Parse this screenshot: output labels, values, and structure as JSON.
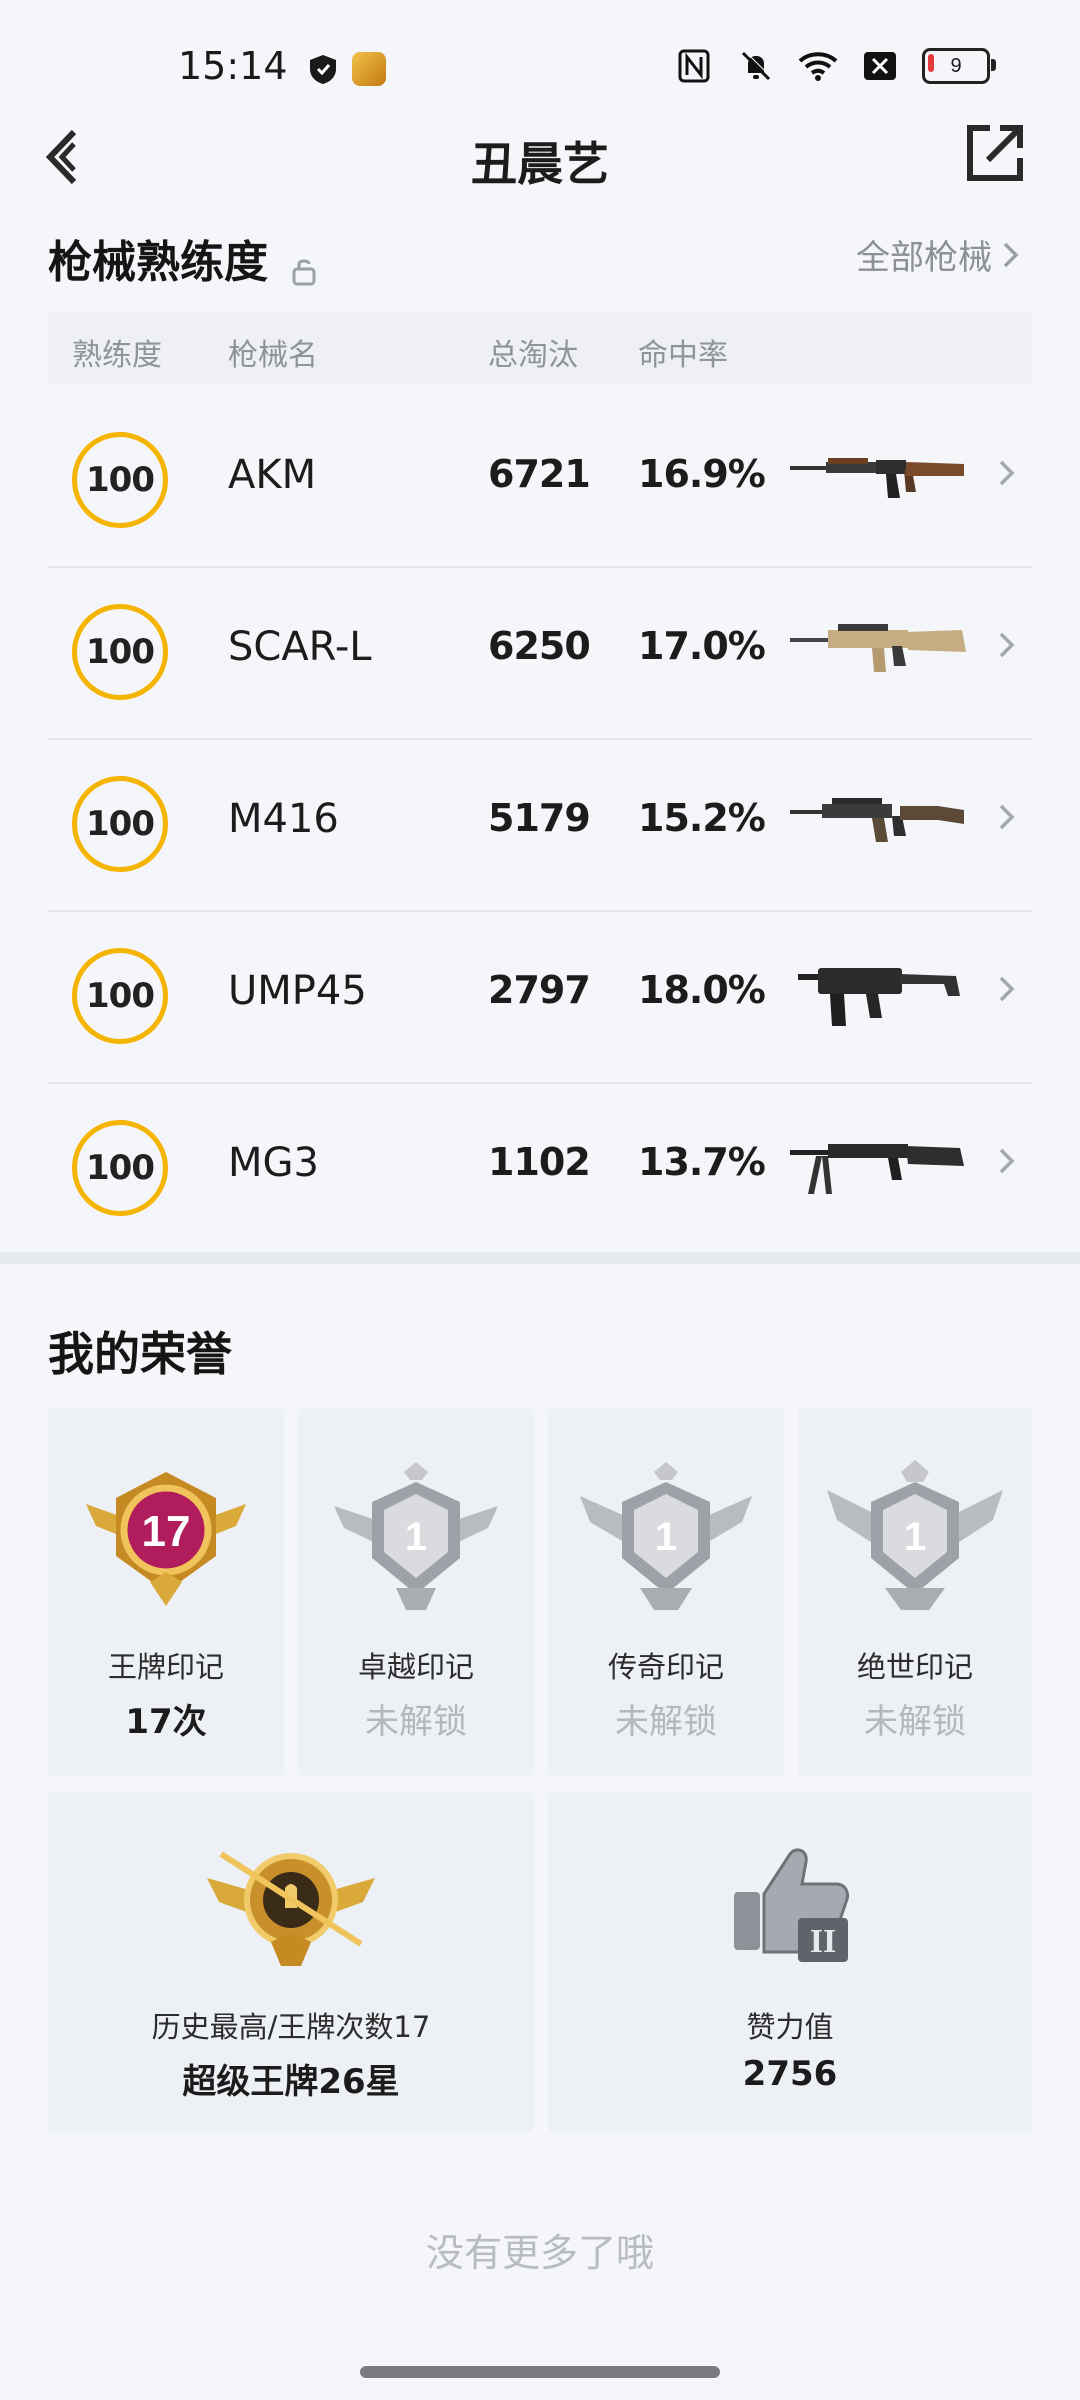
{
  "status_bar": {
    "time": "15:14",
    "battery": "9"
  },
  "header": {
    "title": "丑晨艺"
  },
  "mastery": {
    "title": "枪械熟练度",
    "all_link": "全部枪械",
    "columns": {
      "level": "熟练度",
      "name": "枪械名",
      "kills": "总淘汰",
      "accuracy": "命中率"
    },
    "rows": [
      {
        "level": "100",
        "name": "AKM",
        "kills": "6721",
        "accuracy": "16.9%",
        "gun_icon": "akm-rifle-icon"
      },
      {
        "level": "100",
        "name": "SCAR-L",
        "kills": "6250",
        "accuracy": "17.0%",
        "gun_icon": "scar-rifle-icon"
      },
      {
        "level": "100",
        "name": "M416",
        "kills": "5179",
        "accuracy": "15.2%",
        "gun_icon": "m416-rifle-icon"
      },
      {
        "level": "100",
        "name": "UMP45",
        "kills": "2797",
        "accuracy": "18.0%",
        "gun_icon": "ump-smg-icon"
      },
      {
        "level": "100",
        "name": "MG3",
        "kills": "1102",
        "accuracy": "13.7%",
        "gun_icon": "mg3-lmg-icon"
      }
    ]
  },
  "honor": {
    "title": "我的荣誉",
    "badges": [
      {
        "label": "王牌印记",
        "value": "17次",
        "emblem_number": "17",
        "locked": false
      },
      {
        "label": "卓越印记",
        "value": "未解锁",
        "emblem_number": "1",
        "locked": true
      },
      {
        "label": "传奇印记",
        "value": "未解锁",
        "emblem_number": "1",
        "locked": true
      },
      {
        "label": "绝世印记",
        "value": "未解锁",
        "emblem_number": "1",
        "locked": true
      }
    ],
    "highest": {
      "label": "历史最高/王牌次数17",
      "value": "超级王牌26星"
    },
    "likes": {
      "label": "赞力值",
      "value": "2756",
      "emblem_number": "II"
    }
  },
  "footer": {
    "end_text": "没有更多了哦"
  },
  "colors": {
    "accent_gold": "#f5b400",
    "background": "#f4f6fa",
    "locked_text": "#b4b7bd"
  }
}
